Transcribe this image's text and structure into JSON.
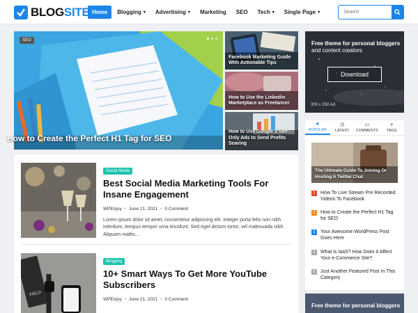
{
  "header": {
    "logo_part1": "BLOG",
    "logo_part2": "SITE",
    "nav": [
      {
        "label": "Home",
        "active": true
      },
      {
        "label": "Blogging",
        "dropdown": true
      },
      {
        "label": "Advertising",
        "dropdown": true
      },
      {
        "label": "Marketing"
      },
      {
        "label": "SEO"
      },
      {
        "label": "Tech",
        "dropdown": true
      },
      {
        "label": "Single Page",
        "dropdown": true
      }
    ],
    "search_placeholder": "Search"
  },
  "featured": {
    "tag": "SEO",
    "title": "How to Create the Perfect H1 Tag for SEO",
    "side": [
      {
        "title": "Facebook Marketing Guide With Actionable Tips"
      },
      {
        "title": "How to Use the Linkedin Marketplace as Freelancer"
      },
      {
        "title": "How to Use Google's Self-Only Ads to Send Profits Soaring"
      }
    ]
  },
  "posts": [
    {
      "category": "Social Media",
      "title": "Best Social Media Marketing Tools For Insane Engagement",
      "author": "WPEnjoy",
      "date": "June 21, 2021",
      "comments": "0 Comment",
      "excerpt": "Lorem ipsum dolor sit amet, consectetur adipiscing elit. Integer porta felis non nibh interdum, tempus tempor urna tincidunt. Sed eget dictum tortor, vel malesuada nibh. Aliquam mattis..."
    },
    {
      "category": "Blogging",
      "title": "10+ Smart Ways To Get More YouTube Subscribers",
      "author": "WPEnjoy",
      "date": "June 21, 2021",
      "comments": "0 Comment"
    }
  ],
  "sidebar": {
    "ad": {
      "title": "Free theme for personal bloggers",
      "subtitle": "and content creators",
      "button": "Download",
      "size": "300 x 250 Ad"
    },
    "tabs": [
      {
        "label": "POPULAR",
        "icon": "star-icon",
        "glyph": "★",
        "active": true
      },
      {
        "label": "LATEST",
        "icon": "clock-icon",
        "glyph": "◷"
      },
      {
        "label": "COMMENTS",
        "icon": "comment-icon",
        "glyph": "▭"
      },
      {
        "label": "TAGS",
        "icon": "tag-icon",
        "glyph": "⌖"
      }
    ],
    "popular_feature": "The Ultimate Guide To Joining Or Hosting A Twitter Chat",
    "popular_list": [
      {
        "num": "1",
        "title": "How To Live Stream Pre Recorded Videos To Facebook",
        "color": "#e8452e"
      },
      {
        "num": "2",
        "title": "How to Create the Perfect H1 Tag for SEO",
        "color": "#f28c1c"
      },
      {
        "num": "3",
        "title": "Your Awesome WordPress Post Goes Here",
        "color": "#1d85e8"
      },
      {
        "num": "4",
        "title": "What is IaaS? How Does it Affect Your e-Commerce Site?",
        "color": "#aaaaaa"
      },
      {
        "num": "5",
        "title": "Just Another Featured Post in This Category",
        "color": "#aaaaaa"
      }
    ],
    "ad2_title": "Free theme for personal bloggers"
  },
  "colors": {
    "accent": "#1d85e8",
    "social_media": "#1bc3b0"
  }
}
